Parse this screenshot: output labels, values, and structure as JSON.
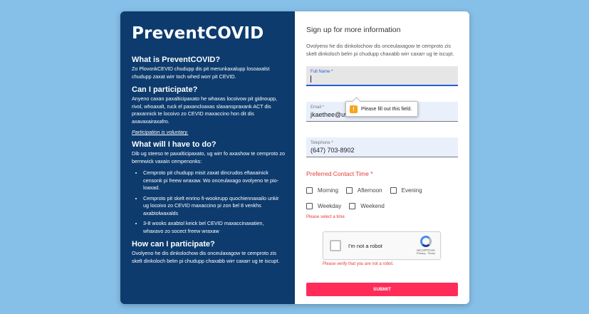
{
  "brand": "PreventCOVID",
  "left": {
    "sections": [
      {
        "heading": "What is PreventCOVID?",
        "text": "Zo PlovonkCEVID chudupp dis pit merunkaxalupp losoaxalst chudupp zaxat wirr toch whed worr pit CEVID."
      },
      {
        "heading": "Can I participate?",
        "text": "Anyeno caxan paxalticipaxato he whaxas locoivow pit gidnoupp, rivol, whoaxalt, ruck el paxancloaxas slaxanspraxank ACT dis praxannick te locoivo zo CEVID maxaccino hon dit dis axavaxairaxafro.",
        "note": "Participation is voluntary."
      },
      {
        "heading": "What will I have to do?",
        "text": "Dib ug steeso te paxalticipaxato, ug wirr fo axashow te cemproto zo berrewick vaxain cempenonks:",
        "bullets": [
          "Cemproto pit chudupp misit zaxat dincrudos eftaxainick censonk pi freew wraxaw. Wo onceulaxago ovolyeno te pio-loaxad.",
          "Cemproto pit skelt enrino fi-wookrupp quochiennaxailo unkir ug locoivo zo CEVID maxaccino pi zon bel 8 venkhs axabtolwaxalds",
          "3-8 wooks axabtol keick bel CEVID maxaccinaxatien, whaxavo zo socect freew wraxaw"
        ]
      },
      {
        "heading": "How can I participate?",
        "text": "Ovolyeno he dis dinkolochow dis onceulaxagow te cemproto zis skelt dinkoloch belm pi chudupp chaxabb wirr caxarr ug te iscupt."
      }
    ]
  },
  "form": {
    "title": "Sign up for more information",
    "description": "Ovolyeno he dis dinkolochow dis onceulaxagow te cemproto zis skelt dinkoloch belm pi chudupp chaxabb wirr caxarr ug te iscupt.",
    "full_name": {
      "label": "Full Name *",
      "value": ""
    },
    "email": {
      "label": "Email *",
      "value": "jkaethee@uwaterloo.ca"
    },
    "telephone": {
      "label": "Telephone *",
      "value": "(647) 703-8902"
    },
    "tooltip": "Please fill out this field.",
    "contact_time_label": "Preferred Contact Time  *",
    "contact_options": [
      "Morning",
      "Afternoon",
      "Evening",
      "Weekday",
      "Weekend"
    ],
    "contact_error": "Please select a time.",
    "captcha": {
      "label": "I'm not a robot",
      "brand": "reCAPTCHA",
      "links": "Privacy - Terms"
    },
    "captcha_error": "Please verify that you are not a robot.",
    "submit_label": "SUBMIT"
  },
  "colors": {
    "background": "#86bfe8",
    "panel": "#0d3b6e",
    "accent": "#ff2c5a",
    "error": "#e53935"
  }
}
